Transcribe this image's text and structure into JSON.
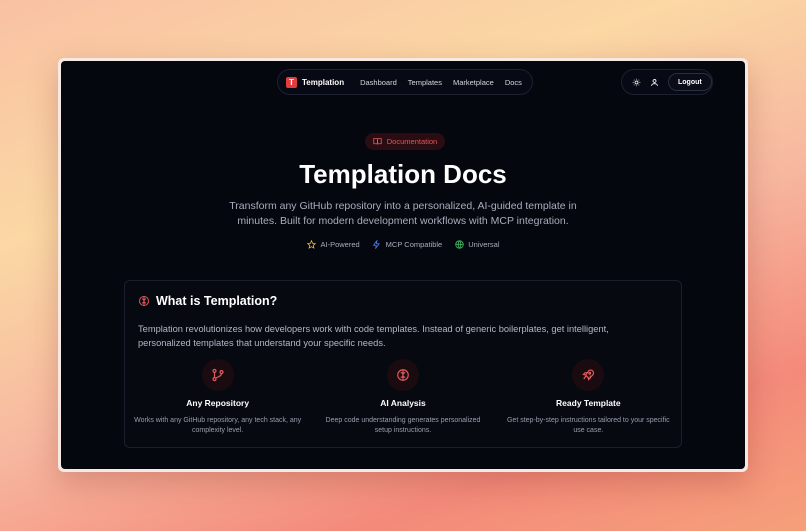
{
  "nav": {
    "logo_letter": "T",
    "brand": "Templation",
    "links": [
      "Dashboard",
      "Templates",
      "Marketplace",
      "Docs"
    ],
    "theme_icon": "sun-icon",
    "user_icon": "user-icon",
    "logout": "Logout"
  },
  "hero": {
    "badge_icon": "book-icon",
    "badge": "Documentation",
    "title": "Templation Docs",
    "subtitle": "Transform any GitHub repository into a personalized, AI-guided template in minutes. Built for modern development workflows with MCP integration.",
    "tags": [
      {
        "icon": "star-icon",
        "label": "AI-Powered",
        "color": "#e6b93c"
      },
      {
        "icon": "bolt-icon",
        "label": "MCP Compatible",
        "color": "#4b7bf0"
      },
      {
        "icon": "globe-icon",
        "label": "Universal",
        "color": "#4bbf6b"
      }
    ]
  },
  "about": {
    "icon": "brain-icon",
    "title": "What is Templation?",
    "text": "Templation revolutionizes how developers work with code templates. Instead of generic boilerplates, get intelligent, personalized templates that understand your specific needs.",
    "features": [
      {
        "icon": "git-branch-icon",
        "title": "Any Repository",
        "desc": "Works with any GitHub repository, any tech stack, any complexity level."
      },
      {
        "icon": "brain-icon",
        "title": "AI Analysis",
        "desc": "Deep code understanding generates personalized setup instructions."
      },
      {
        "icon": "rocket-icon",
        "title": "Ready Template",
        "desc": "Get step-by-step instructions tailored to your specific use case."
      }
    ]
  },
  "colors": {
    "accent": "#e23d3d",
    "background": "#05070f"
  }
}
